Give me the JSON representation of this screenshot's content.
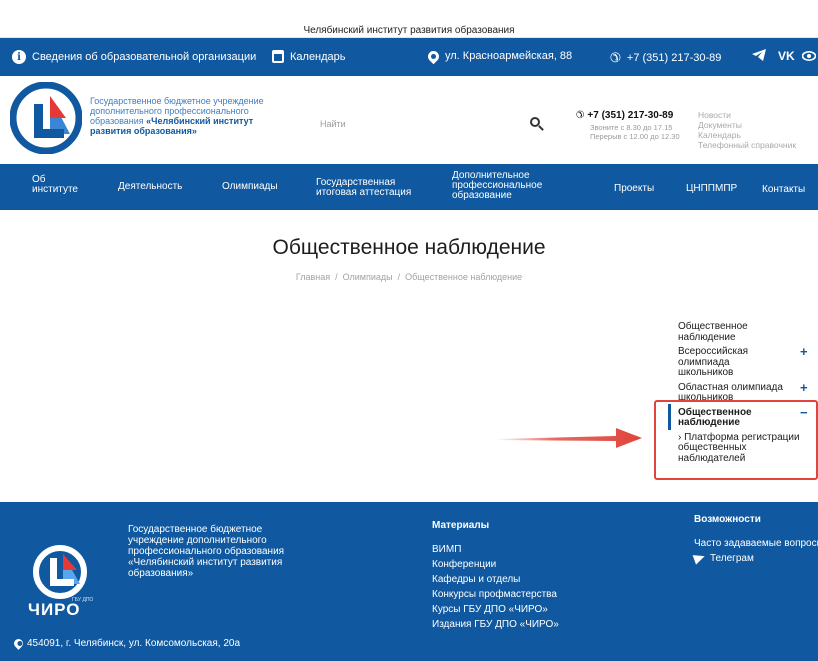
{
  "site_title": "Челябинский институт развития образования",
  "info_bar": {
    "org_info": "Сведения об образовательной организации",
    "calendar": "Календарь",
    "address": "ул. Красноармейская, 88",
    "phone": "+7 (351) 217-30-89",
    "social": [
      "telegram-icon",
      "vk-icon",
      "eye-icon"
    ],
    "vk_label": "VK"
  },
  "header": {
    "org_line1": "Государственное бюджетное учреждение",
    "org_line2": "дополнительного профессионального",
    "org_line3_prefix": "образования ",
    "org_line3_bold": "«Челябинский институт",
    "org_line4_bold": "развития образования»",
    "search_placeholder": "Найти",
    "phone": "+7 (351) 217-30-89",
    "hours_line1": "Звоните с 8.30 до 17.15",
    "hours_line2": "Перерыв с 12.00 до 12.30",
    "quick_links": [
      "Новости",
      "Документы",
      "Календарь",
      "Телефонный справочник"
    ]
  },
  "nav": {
    "about_line1": "Об",
    "about_line2": "институте",
    "activity": "Деятельность",
    "olympiads": "Олимпиады",
    "gia_line1": "Государственная",
    "gia_line2": "итоговая аттестация",
    "dpo_line1": "Дополнительное",
    "dpo_line2": "профессиональное",
    "dpo_line3": "образование",
    "projects": "Проекты",
    "cnppmpr": "ЦНППМПР",
    "contacts": "Контакты"
  },
  "page": {
    "title": "Общественное наблюдение",
    "breadcrumb": [
      "Главная",
      "Олимпиады",
      "Общественное наблюдение"
    ],
    "breadcrumb_sep": "/"
  },
  "side_menu": {
    "item1_line1": "Общественное",
    "item1_line2": "наблюдение",
    "item2_line1": "Всероссийская олимпиада",
    "item2_line2": "школьников",
    "item3_line1": "Областная олимпиада",
    "item3_line2": "школьников",
    "item4_line1": "Общественное",
    "item4_line2": "наблюдение",
    "sub_line1": "› Платформа регистрации",
    "sub_line2": "общественных",
    "sub_line3": "наблюдателей",
    "plus": "+",
    "minus": "−"
  },
  "footer": {
    "org_text": "Государственное бюджетное учреждение дополнительного профессионального образования «Челябинский институт развития образования»",
    "brand": "ЧИРО",
    "brand_small": "ГБУ ДПО",
    "address": "454091, г. Челябинск, ул. Комсомольская, 20а",
    "materials_title": "Материалы",
    "materials": [
      "ВИМП",
      "Конференции",
      "Кафедры и отделы",
      "Конкурсы профмастерства",
      "Курсы ГБУ ДПО «ЧИРО»",
      "Издания ГБУ ДПО «ЧИРО»"
    ],
    "features_title": "Возможности",
    "faq": "Часто задаваемые вопросы",
    "telegram": "Телеграм"
  },
  "colors": {
    "brand_blue": "#1059a0",
    "highlight_red": "#e0443a"
  }
}
